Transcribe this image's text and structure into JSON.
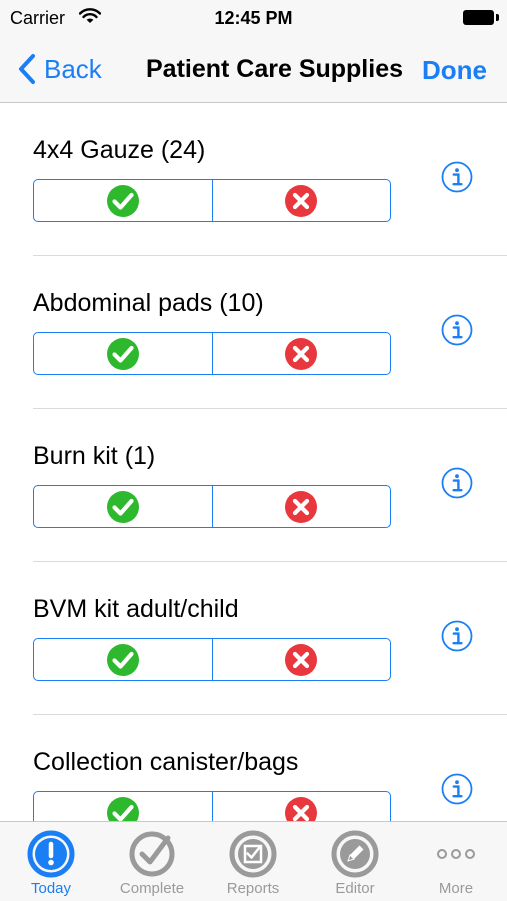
{
  "status_bar": {
    "carrier": "Carrier",
    "time": "12:45 PM"
  },
  "nav": {
    "back_label": "Back",
    "title": "Patient Care Supplies",
    "done_label": "Done"
  },
  "items": [
    {
      "label": "4x4 Gauze (24)"
    },
    {
      "label": "Abdominal pads (10)"
    },
    {
      "label": "Burn kit (1)"
    },
    {
      "label": "BVM kit adult/child"
    },
    {
      "label": "Collection canister/bags"
    }
  ],
  "tabs": [
    {
      "label": "Today",
      "icon": "exclamation-circle-icon",
      "active": true
    },
    {
      "label": "Complete",
      "icon": "checkmark-circle-icon",
      "active": false
    },
    {
      "label": "Reports",
      "icon": "report-check-icon",
      "active": false
    },
    {
      "label": "Editor",
      "icon": "pencil-circle-icon",
      "active": false
    },
    {
      "label": "More",
      "icon": "more-dots-icon",
      "active": false
    }
  ],
  "colors": {
    "accent": "#1a7ff5",
    "check_green": "#2eb82e",
    "cross_red": "#e8383d",
    "tab_inactive": "#9a9a9a"
  }
}
